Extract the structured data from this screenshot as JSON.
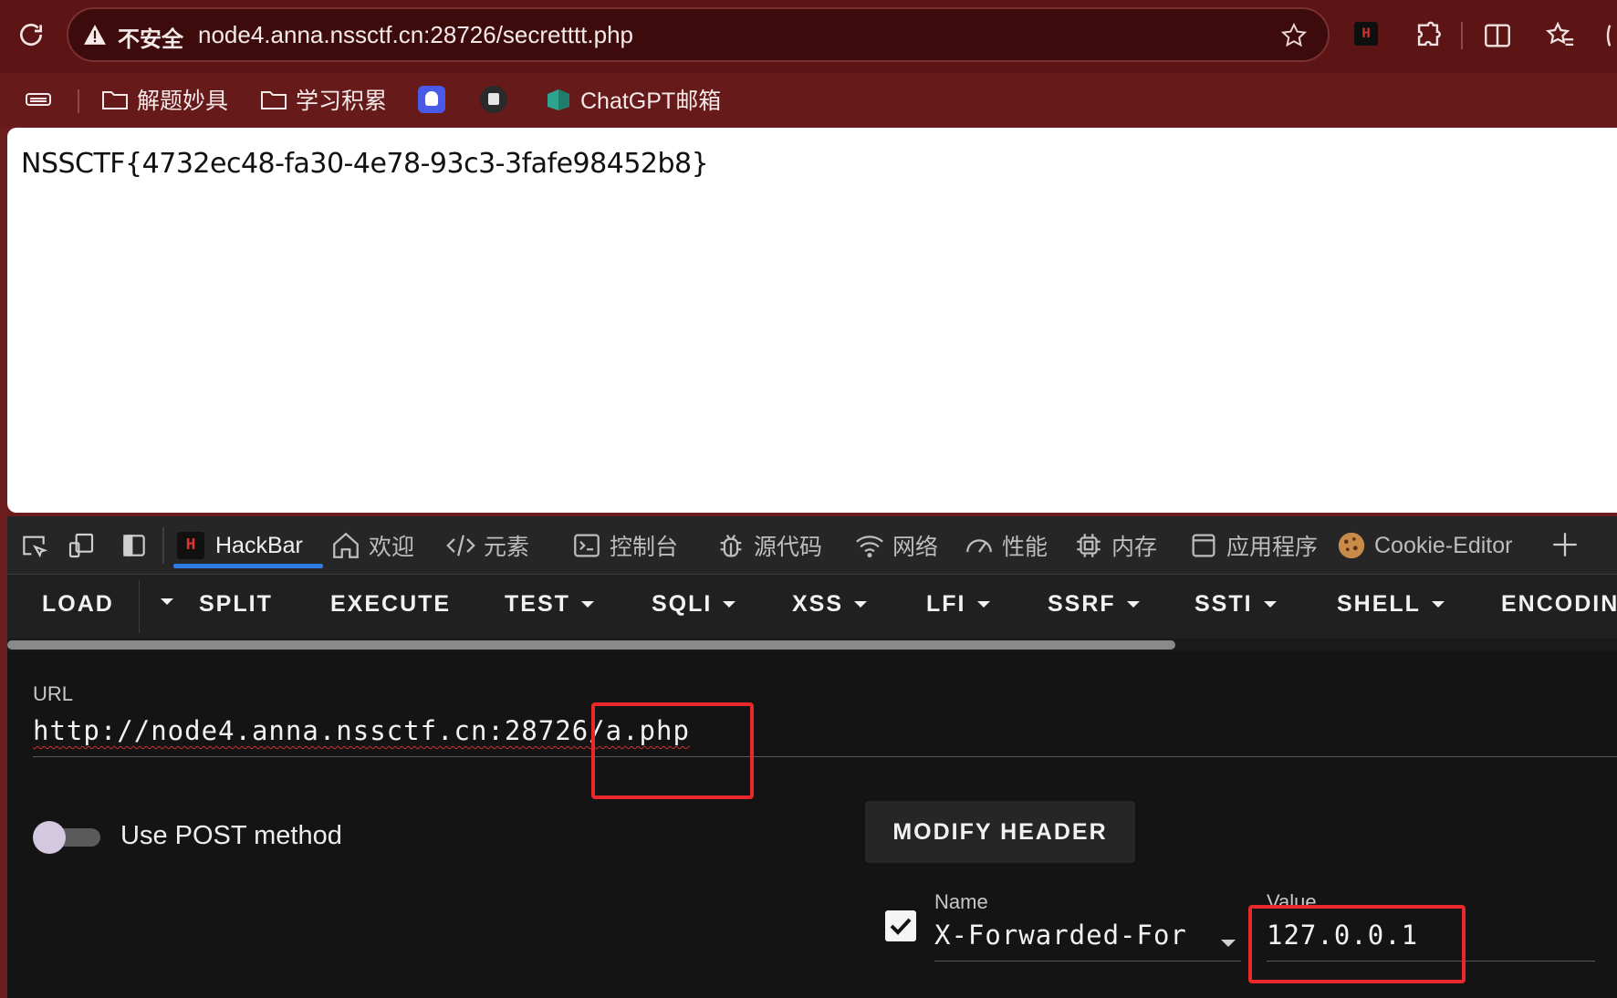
{
  "browser": {
    "insecure_label": "不安全",
    "url": "node4.anna.nssctf.cn:28726/secretttt.php",
    "hackbar_ext_letter": "H"
  },
  "bookmarks": {
    "folder_1": "解题妙具",
    "folder_2": "学习积累",
    "chatgpt": "ChatGPT邮箱"
  },
  "page": {
    "flag": "NSSCTF{4732ec48-fa30-4e78-93c3-3fafe98452b8}"
  },
  "devtools": {
    "tabs": {
      "hackbar": "HackBar",
      "welcome": "欢迎",
      "elements": "元素",
      "console": "控制台",
      "sources": "源代码",
      "network": "网络",
      "performance": "性能",
      "memory": "内存",
      "application": "应用程序",
      "cookie_editor": "Cookie-Editor"
    },
    "active_tab": "HackBar",
    "accent_color": "#2f7ce6"
  },
  "hackbar": {
    "menu": {
      "load": "LOAD",
      "split": "SPLIT",
      "execute": "EXECUTE",
      "test": "TEST",
      "sqli": "SQLI",
      "xss": "XSS",
      "lfi": "LFI",
      "ssrf": "SSRF",
      "ssti": "SSTI",
      "shell": "SHELL",
      "encoding": "ENCODIN"
    },
    "url_label": "URL",
    "url_base": "http://node4.anna.nssctf.cn:28726",
    "url_path": "/a.php",
    "post_label": "Use POST method",
    "post_enabled": false,
    "modify_header_label": "MODIFY HEADER",
    "header": {
      "enabled": true,
      "name_label": "Name",
      "name": "X-Forwarded-For",
      "value_label": "Value",
      "value": "127.0.0.1"
    },
    "highlight_color": "#e8282b"
  }
}
